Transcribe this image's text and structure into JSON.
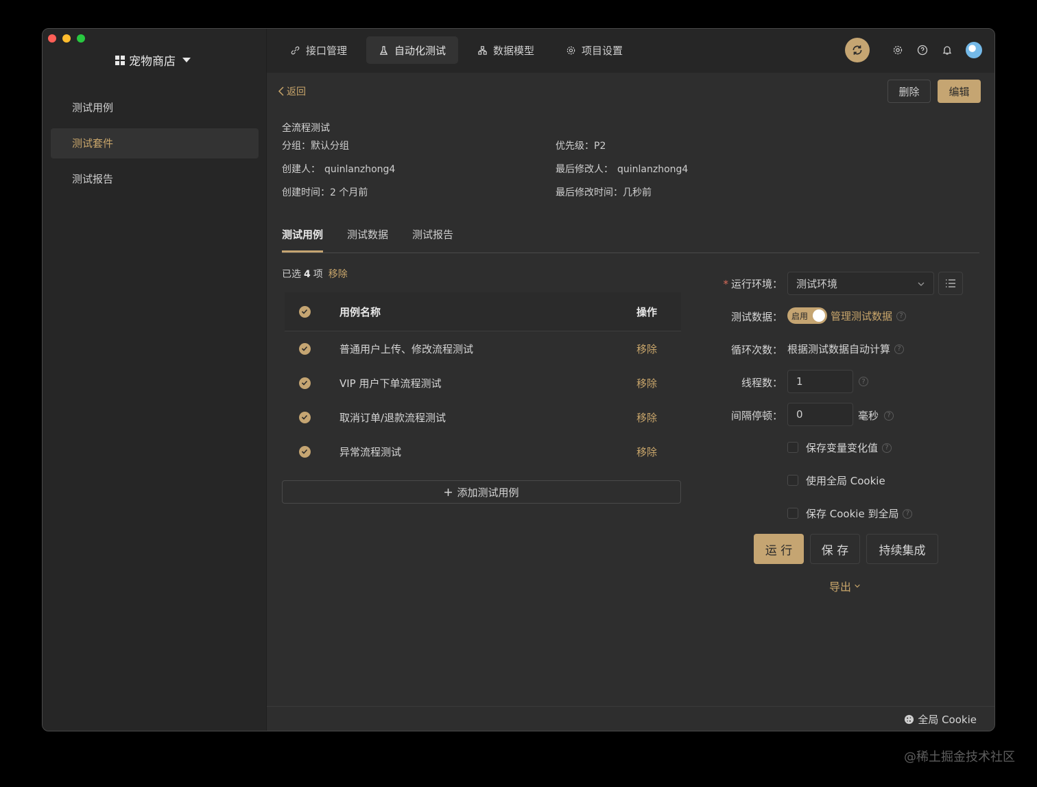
{
  "project": {
    "name": "宠物商店"
  },
  "sidebar": {
    "items": [
      {
        "label": "测试用例"
      },
      {
        "label": "测试套件"
      },
      {
        "label": "测试报告"
      }
    ]
  },
  "topnav": {
    "tabs": [
      {
        "label": "接口管理",
        "icon": "link-icon"
      },
      {
        "label": "自动化测试",
        "icon": "flask-icon"
      },
      {
        "label": "数据模型",
        "icon": "hierarchy-icon"
      },
      {
        "label": "项目设置",
        "icon": "gear-icon"
      }
    ]
  },
  "header": {
    "back": "返回",
    "delete": "删除",
    "edit": "编辑"
  },
  "suite": {
    "title": "全流程测试",
    "group_label": "分组：",
    "group": "默认分组",
    "priority_label": "优先级：",
    "priority": "P2",
    "creator_label": "创建人：",
    "creator": "quinlanzhong4",
    "modifier_label": "最后修改人：",
    "modifier": "quinlanzhong4",
    "created_label": "创建时间：",
    "created": "2 个月前",
    "modified_label": "最后修改时间：",
    "modified": "几秒前"
  },
  "detail_tabs": [
    "测试用例",
    "测试数据",
    "测试报告"
  ],
  "selection": {
    "prefix": "已选",
    "count": "4",
    "suffix": "项",
    "remove": "移除"
  },
  "table": {
    "headers": {
      "name": "用例名称",
      "op": "操作"
    },
    "rows": [
      {
        "name": "普通用户上传、修改流程测试",
        "op": "移除"
      },
      {
        "name": "VIP 用户下单流程测试",
        "op": "移除"
      },
      {
        "name": "取消订单/退款流程测试",
        "op": "移除"
      },
      {
        "name": "异常流程测试",
        "op": "移除"
      }
    ],
    "add": "添加测试用例"
  },
  "form": {
    "env_label": "运行环境：",
    "env_value": "测试环境",
    "data_label": "测试数据：",
    "toggle_text": "启用",
    "manage_data": "管理测试数据",
    "loop_label": "循环次数：",
    "loop_value": "根据测试数据自动计算",
    "threads_label": "线程数：",
    "threads_value": "1",
    "interval_label": "间隔停顿：",
    "interval_value": "0",
    "interval_unit": "毫秒",
    "opt_save_vars": "保存变量变化值",
    "opt_global_cookie": "使用全局 Cookie",
    "opt_save_cookie": "保存 Cookie 到全局"
  },
  "actions": {
    "run": "运 行",
    "save": "保 存",
    "ci": "持续集成",
    "export": "导出"
  },
  "footer": {
    "cookie": "全局 Cookie"
  },
  "watermark": "@稀土掘金技术社区",
  "colors": {
    "accent": "#c5a572",
    "bg": "#2e2e2e",
    "sidebar": "#262626"
  }
}
